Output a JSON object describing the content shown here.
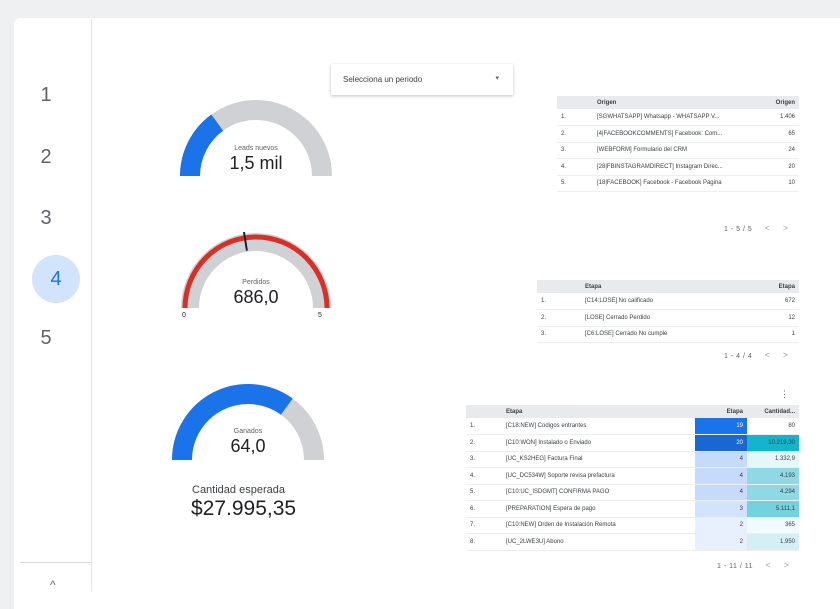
{
  "nav": {
    "items": [
      "1",
      "2",
      "3",
      "4",
      "5"
    ],
    "active": "4",
    "more_icon": "chevron-up-icon"
  },
  "period": {
    "placeholder": "Selecciona un periodo",
    "caret": "▾"
  },
  "gauges": {
    "leads": {
      "label": "Leads nuevos",
      "value": "1,5 mil",
      "fill_fraction": 0.3,
      "color": "#1a73e8"
    },
    "perdidos": {
      "label": "Perdidos",
      "value": "686,0",
      "min": "0",
      "max": "5",
      "fill_fraction": 1.0,
      "color": "#d93025",
      "target_fraction": 0.45
    },
    "ganados": {
      "label": "Ganados",
      "value": "64,0",
      "fill_fraction": 0.7,
      "color": "#1a73e8"
    }
  },
  "amount": {
    "label": "Cantidad esperada",
    "value": "$27.995,35"
  },
  "table_origen": {
    "headers": [
      "",
      "Origen",
      "Origen"
    ],
    "rows": [
      [
        "1.",
        "[SGWHATSAPP] Whatsapp - WHATSAPP V...",
        "1.406"
      ],
      [
        "2.",
        "[4|FACEBOOKCOMMENTS] Facebook: Com...",
        "65"
      ],
      [
        "3.",
        "[WEBFORM] Formulario del CRM",
        "24"
      ],
      [
        "4.",
        "[28|FBINSTAGRAMDIRECT] Instagram Direc...",
        "20"
      ],
      [
        "5.",
        "[18|FACEBOOK] Facebook - Facebook Página",
        "10"
      ]
    ],
    "pager": "1 - 5 / 5"
  },
  "table_etapa": {
    "headers": [
      "",
      "Etapa",
      "Etapa"
    ],
    "rows": [
      [
        "1.",
        "[C14:LOSE] No calificado",
        "672"
      ],
      [
        "2.",
        "[LOSE] Cerrado Perdido",
        "12"
      ],
      [
        "3.",
        "[C6:LOSE] Cerrado No cumple",
        "1"
      ]
    ],
    "pager": "1 - 4 / 4"
  },
  "table_cantidad": {
    "headers": [
      "",
      "Etapa",
      "Etapa",
      "Cantidad..."
    ],
    "rows": [
      [
        "1.",
        "[C18:NEW] Codigos entrantes",
        "19",
        "80"
      ],
      [
        "2.",
        "[C10:WON] Instalado o Enviado",
        "20",
        "10.219,30"
      ],
      [
        "3.",
        "[UC_KS2HEG] Factura Final",
        "4",
        "1.332,9"
      ],
      [
        "4.",
        "[UC_DC534W] Soporte revisa prefactura",
        "4",
        "4.193"
      ],
      [
        "5.",
        "[C10:UC_ISDGMT] CONFIRMA PAGO",
        "4",
        "4.294"
      ],
      [
        "6.",
        "[PREPARATION] Espera de pago",
        "3",
        "5.111,1"
      ],
      [
        "7.",
        "[C10:NEW] Orden de Instalación Remota",
        "2",
        "365"
      ],
      [
        "8.",
        "[UC_2LWE3U] Abono",
        "2",
        "1.950"
      ]
    ],
    "etapa_colors": [
      "#1a73e8",
      "#1967d2",
      "#c6dafc",
      "#c6dafc",
      "#c6dafc",
      "#d2e3fc",
      "#e8f0fe",
      "#e8f0fe"
    ],
    "cantidad_colors": [
      "#ffffff",
      "#12b5cb",
      "#e6f7fa",
      "#8ed9e5",
      "#8ed9e5",
      "#74d1df",
      "#f1fafc",
      "#d4f0f5"
    ],
    "pager": "1 - 11 / 11",
    "menu_icon": "⋮"
  }
}
